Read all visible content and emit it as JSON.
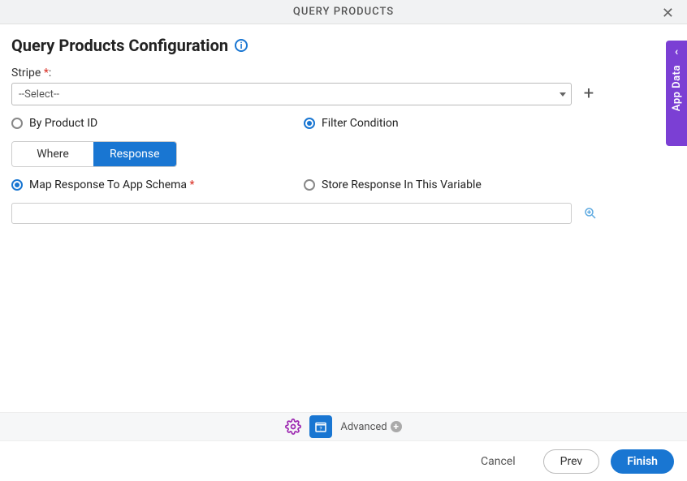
{
  "header": {
    "title": "QUERY PRODUCTS"
  },
  "page_title": "Query Products Configuration",
  "stripe": {
    "label": "Stripe",
    "selected": "--Select--"
  },
  "query_mode": {
    "by_product_id": "By Product ID",
    "filter_condition": "Filter Condition"
  },
  "tabs": {
    "where": "Where",
    "response": "Response"
  },
  "response_mode": {
    "map_to_schema": "Map Response To App Schema",
    "store_in_variable": "Store Response In This Variable"
  },
  "map_input_value": "",
  "toolbar": {
    "advanced": "Advanced"
  },
  "side_tab": {
    "label": "App Data"
  },
  "footer": {
    "cancel": "Cancel",
    "prev": "Prev",
    "finish": "Finish"
  }
}
